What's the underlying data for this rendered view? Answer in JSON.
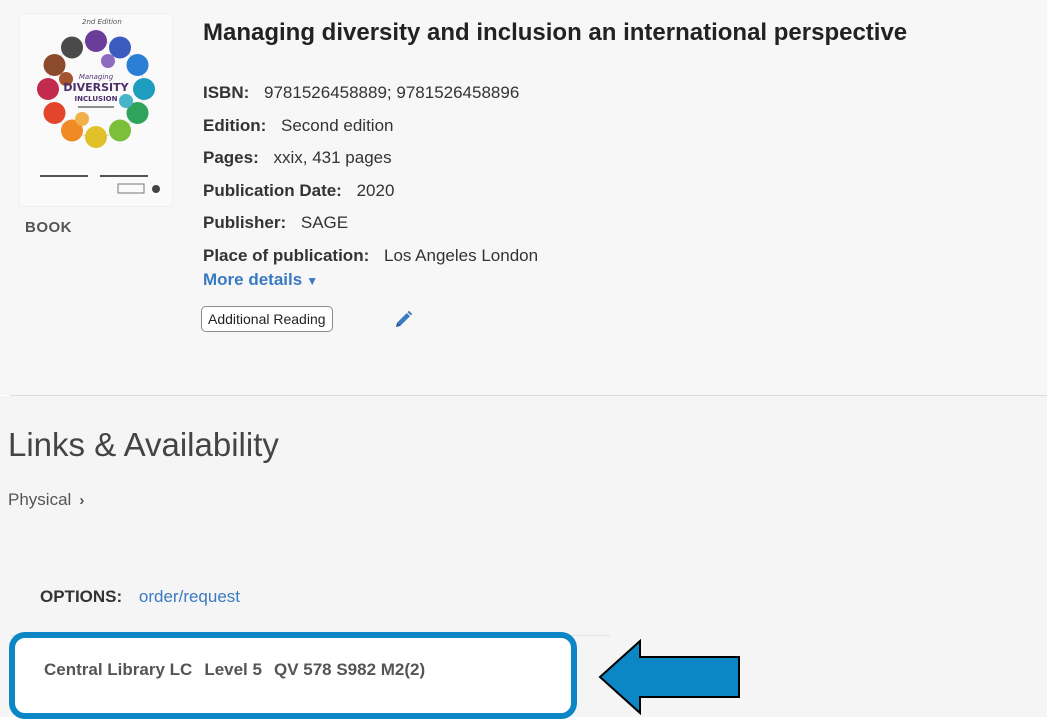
{
  "record": {
    "title": "Managing diversity and inclusion an international perspective",
    "type": "BOOK",
    "cover_alt": "Book cover: circle of colorful hands",
    "fields": [
      {
        "label": "ISBN:",
        "value": "9781526458889; 9781526458896"
      },
      {
        "label": "Edition:",
        "value": "Second edition"
      },
      {
        "label": "Pages:",
        "value": "xxix, 431 pages"
      },
      {
        "label": "Publication Date:",
        "value": "2020"
      },
      {
        "label": "Publisher:",
        "value": "SAGE"
      },
      {
        "label": "Place of publication:",
        "value": "Los Angeles London"
      }
    ],
    "more_details": "More details",
    "tag": "Additional Reading"
  },
  "availability": {
    "heading": "Links & Availability",
    "physical": "Physical",
    "options_label": "OPTIONS:",
    "options_link": "order/request",
    "location": {
      "library": "Central Library LC",
      "level": "Level 5",
      "call_number": "QV 578 S982 M2(2)"
    }
  },
  "colors": {
    "link": "#3a7ac2",
    "highlight": "#0d86c6"
  },
  "icons": [
    "pencil-icon",
    "chevron-down-icon",
    "chevron-right-icon",
    "arrow-left-icon"
  ]
}
